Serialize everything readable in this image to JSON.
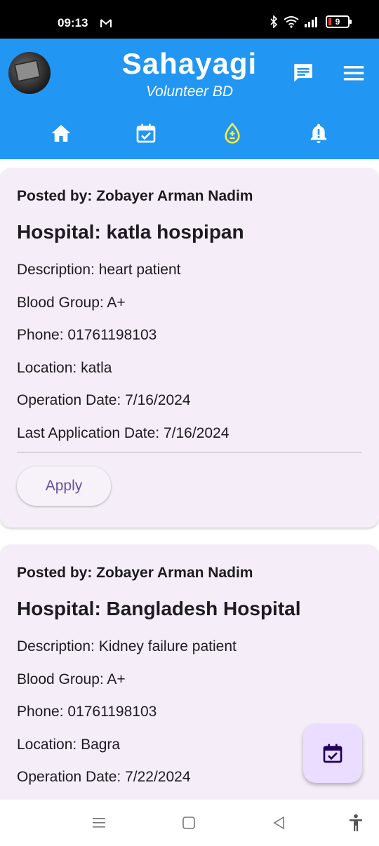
{
  "status_bar": {
    "time": "09:13",
    "mail_icon": "gmail-icon",
    "icons": [
      "bluetooth-icon",
      "wifi-icon",
      "signal-icon"
    ],
    "battery": "9",
    "battery_color": "#e53935"
  },
  "header": {
    "title": "Sahayagi",
    "subtitle": "Volunteer BD",
    "bg_color": "#2196f3",
    "actions": [
      {
        "name": "chat-icon"
      },
      {
        "name": "menu-icon"
      }
    ]
  },
  "nav_tabs": [
    {
      "name": "home-icon",
      "active": false
    },
    {
      "name": "calendar-check-icon",
      "active": false
    },
    {
      "name": "blood-drop-icon",
      "active": true,
      "active_color": "#ffeb3b"
    },
    {
      "name": "notification-alert-icon",
      "active": false
    }
  ],
  "posts": [
    {
      "posted_by": "Posted by: Zobayer Arman Nadim",
      "hospital": "Hospital: katla hospipan",
      "description": "Description: heart patient",
      "blood_group": "Blood Group: A+",
      "phone": "Phone: 01761198103",
      "location": "Location: katla",
      "operation_date": "Operation Date: 7/16/2024",
      "last_application_date": "Last Application Date: 7/16/2024",
      "apply_label": "Apply"
    },
    {
      "posted_by": "Posted by: Zobayer Arman Nadim",
      "hospital": "Hospital: Bangladesh Hospital",
      "description": "Description: Kidney failure patient",
      "blood_group": "Blood Group: A+",
      "phone": "Phone: 01761198103",
      "location": "Location: Bagra",
      "operation_date": "Operation Date: 7/22/2024"
    }
  ],
  "fab": {
    "icon": "calendar-check-icon",
    "bg_color": "#eaddff"
  },
  "system_nav": [
    "recents-icon",
    "home-square-icon",
    "back-icon",
    "accessibility-icon"
  ]
}
